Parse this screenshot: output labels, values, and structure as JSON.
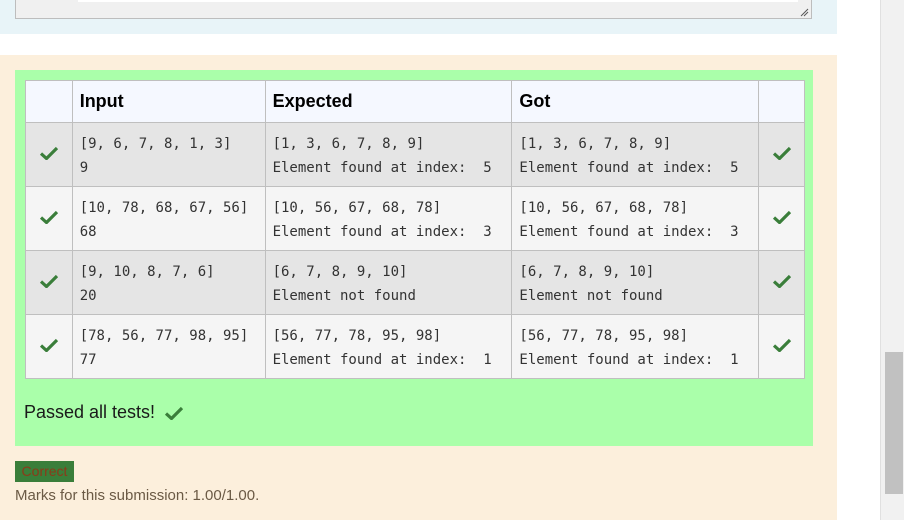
{
  "results_table": {
    "headers": [
      "",
      "Input",
      "Expected",
      "Got",
      ""
    ],
    "rows": [
      {
        "input": [
          "[9, 6, 7, 8, 1, 3]",
          "9"
        ],
        "expected": [
          "[1, 3, 6, 7, 8, 9]",
          "Element found at index:  5"
        ],
        "got": [
          "[1, 3, 6, 7, 8, 9]",
          "Element found at index:  5"
        ]
      },
      {
        "input": [
          "[10, 78, 68, 67, 56]",
          "68"
        ],
        "expected": [
          "[10, 56, 67, 68, 78]",
          "Element found at index:  3"
        ],
        "got": [
          "[10, 56, 67, 68, 78]",
          "Element found at index:  3"
        ]
      },
      {
        "input": [
          "[9, 10, 8, 7, 6]",
          "20"
        ],
        "expected": [
          "[6, 7, 8, 9, 10]",
          "Element not found"
        ],
        "got": [
          "[6, 7, 8, 9, 10]",
          "Element not found"
        ]
      },
      {
        "input": [
          "[78, 56, 77, 98, 95]",
          "77"
        ],
        "expected": [
          "[56, 77, 78, 95, 98]",
          "Element found at index:  1"
        ],
        "got": [
          "[56, 77, 78, 95, 98]",
          "Element found at index:  1"
        ]
      }
    ]
  },
  "summary": {
    "passed_text": "Passed all tests!"
  },
  "grade": {
    "badge": "Correct",
    "marks": "Marks for this submission: 1.00/1.00."
  },
  "colors": {
    "check": "#3a7e3a",
    "pass_background": "#aaffaa",
    "outcome_background": "#fcefdc"
  },
  "icons": {
    "pass": "check-icon",
    "resize": "resize-grip-icon"
  }
}
